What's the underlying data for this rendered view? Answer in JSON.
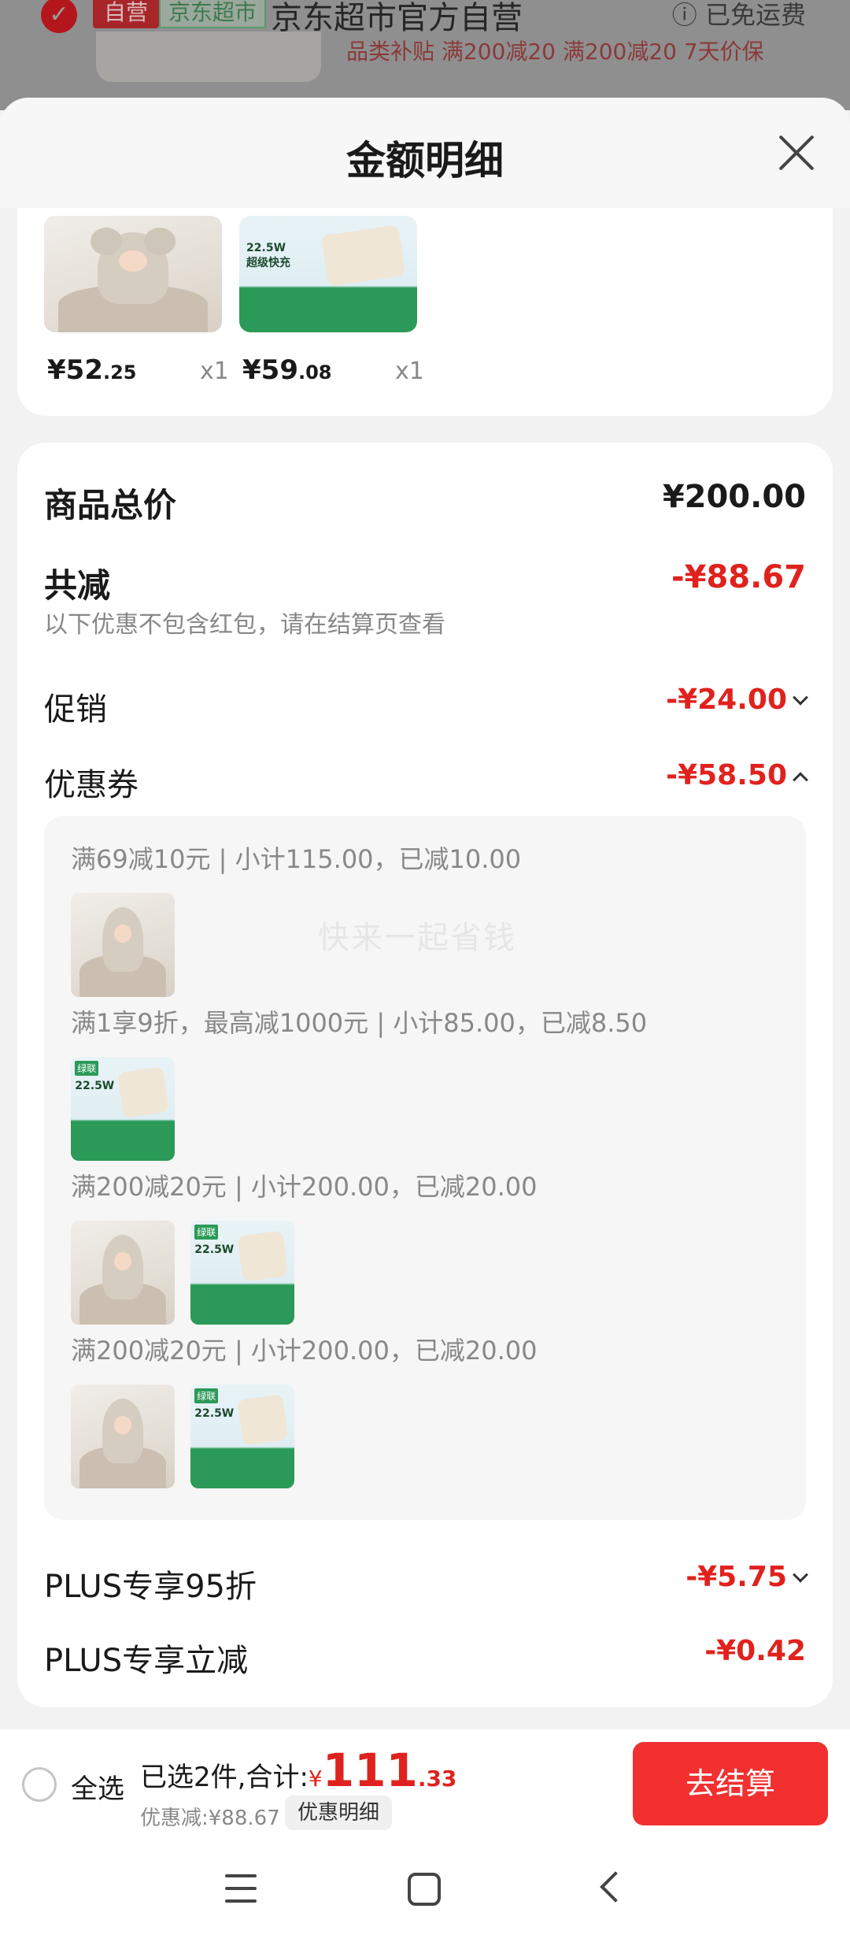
{
  "background": {
    "store_name": "京东超市官方自营",
    "tag_self": "自营",
    "tag_super": "京东超市",
    "free_shipping": "已免运费",
    "promo_text": "品类补贴 满200减20  满200减20  7天价保"
  },
  "sheet": {
    "title": "金额明细"
  },
  "products": [
    {
      "price_int": "¥52",
      "price_dec": ".25",
      "qty": "x1",
      "icon": "baby-towel"
    },
    {
      "price_int": "¥59",
      "price_dec": ".08",
      "qty": "x1",
      "icon": "power-bank"
    }
  ],
  "summary": {
    "total_label": "商品总价",
    "total_value": "¥200.00",
    "reduce_label": "共减",
    "reduce_value": "-¥88.67",
    "reduce_note": "以下优惠不包含红包，请在结算页查看",
    "promo_label": "促销",
    "promo_value": "-¥24.00",
    "coupon_label": "优惠券",
    "coupon_value": "-¥58.50",
    "plus95_label": "PLUS专享95折",
    "plus95_value": "-¥5.75",
    "plus_reduce_label": "PLUS专享立减",
    "plus_reduce_value": "-¥0.42"
  },
  "coupons": [
    {
      "title": "满69减10元 | 小计115.00，已减10.00",
      "items": [
        "baby-towel"
      ]
    },
    {
      "title": "满1享9折，最高减1000元 | 小计85.00，已减8.50",
      "items": [
        "power-bank"
      ]
    },
    {
      "title": "满200减20元 | 小计200.00，已减20.00",
      "items": [
        "baby-towel",
        "power-bank"
      ]
    },
    {
      "title": "满200减20元 | 小计200.00，已减20.00",
      "items": [
        "baby-towel",
        "power-bank"
      ]
    }
  ],
  "watermark": "快来一起省钱",
  "bottom": {
    "select_all": "全选",
    "selected_text": "已选2件,合计:",
    "currency": "¥",
    "amount_int": "111",
    "amount_dec": ".33",
    "discount_text": "优惠减:¥88.67",
    "detail_button": "优惠明细",
    "checkout_button": "去结算"
  },
  "colors": {
    "accent": "#e0221e",
    "checkout": "#f23030"
  }
}
